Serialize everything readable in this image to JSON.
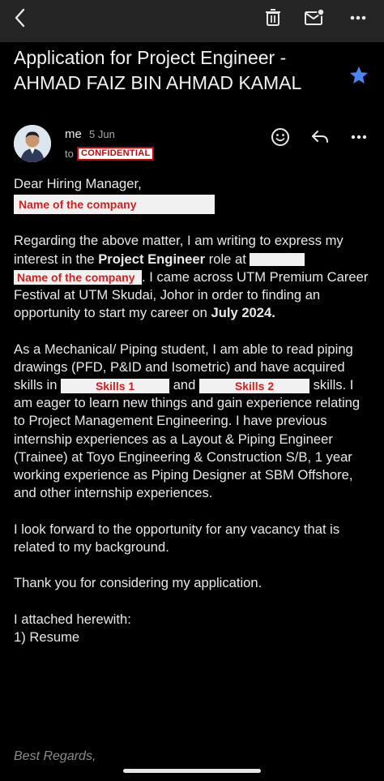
{
  "toolbar": {
    "back_icon": "back-arrow-icon",
    "actions": [
      "delete-icon",
      "mark-unread-icon",
      "more-icon"
    ]
  },
  "email": {
    "subject": "Application for Project Engineer - AHMAD FAIZ BIN AHMAD KAMAL",
    "sender": "me",
    "date": "5 Jun",
    "to_label": "to",
    "label_badge": "CONFIDENTIAL"
  },
  "body": {
    "greeting": "Dear Hiring Manager,",
    "company_placeholder_1": "Name of the company",
    "p1_a": "Regarding the above matter, I am writing to express my interest in the ",
    "p1_bold_role": "Project Engineer",
    "p1_b": " role at ",
    "company_placeholder_2": "Name of the company",
    "p1_c": ". I came across UTM Premium Career Festival at UTM Skudai, Johor in order to finding an opportunity to start my career on ",
    "p1_bold_date": "July 2024.",
    "p2_a": "As a Mechanical/ Piping student, I am able to read piping drawings (PFD, P&ID and Isometric) and have acquired skills in ",
    "skills_1": "Skills 1",
    "p2_and": " and ",
    "skills_2": "Skills 2",
    "p2_b": " skills. I am eager to learn new things and gain experience relating to Project Management Engineering. I have previous internship experiences as a Layout & Piping Engineer (Trainee) at Toyo Engineering & Construction S/B, 1 year working experience as Piping Designer at SBM Offshore, and other internship experiences.",
    "p3": "I look forward to the opportunity for any vacancy that is related to my background.",
    "p4": "Thank you for considering my application.",
    "p5_line1": "I attached herewith:",
    "p5_line2": "1) Resume",
    "signoff": "Best Regards,"
  },
  "colors": {
    "background": "#000000",
    "toolbar": "#252525",
    "star": "#4a86f0",
    "redaction_text": "#d61f1f"
  }
}
